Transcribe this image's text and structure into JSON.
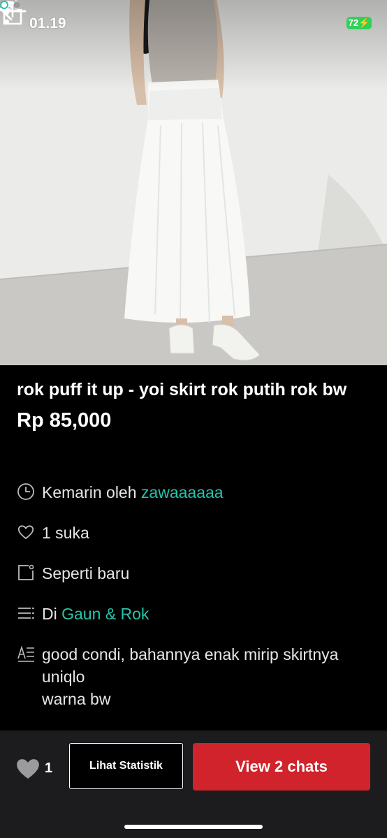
{
  "status_bar": {
    "time": "01.19",
    "battery": "72"
  },
  "product": {
    "title": "rok puff it up - yoi skirt rok putih rok bw",
    "price": "Rp 85,000",
    "posted_prefix": "Kemarin oleh ",
    "seller": "zawaaaaaa",
    "likes_text": "1 suka",
    "condition": "Seperti baru",
    "category_prefix": "Di ",
    "category": "Gaun & Rok",
    "description_lines": [
      "good condi, bahannya enak mirip skirtnya uniqlo",
      "warna bw"
    ]
  },
  "carousel": {
    "count": 2,
    "active": 1
  },
  "bottom_bar": {
    "like_count": "1",
    "stats_label": "Lihat Statistik",
    "chat_label": "View 2 chats"
  },
  "colors": {
    "accent": "#27c3a8",
    "chat_button": "#d0232b",
    "battery": "#30d158"
  }
}
